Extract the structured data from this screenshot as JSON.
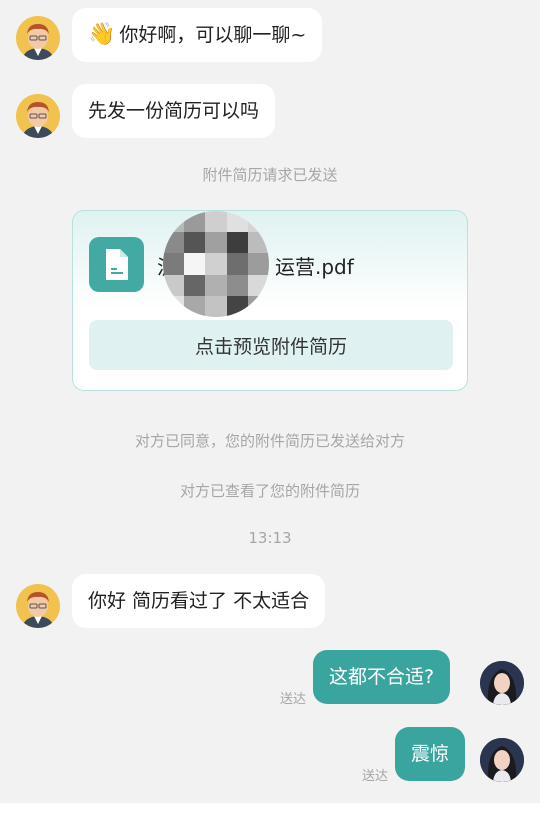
{
  "messages": {
    "m1": {
      "emoji": "👋",
      "text": "你好啊，可以聊一聊~"
    },
    "m2": {
      "text": "先发一份简历可以吗"
    },
    "m3": {
      "text": "你好 简历看过了 不太适合"
    },
    "r1": {
      "text": "这都不合适?",
      "status": "送达"
    },
    "r2": {
      "text": "震惊",
      "status": "送达"
    }
  },
  "system": {
    "request_sent": "附件简历请求已发送",
    "agreed": "对方已同意，您的附件简历已发送给对方",
    "viewed": "对方已查看了您的附件简历",
    "time": "13:13"
  },
  "attachment": {
    "file_prefix": "泸",
    "file_suffix": "运营.pdf",
    "preview_label": "点击预览附件简历"
  },
  "colors": {
    "accent": "#3aa59f",
    "background": "#f2f2f2",
    "bubble_left": "#ffffff",
    "system_text": "#a6a6a6"
  },
  "icons": {
    "file": "document-icon",
    "wave": "waving-hand-emoji"
  }
}
